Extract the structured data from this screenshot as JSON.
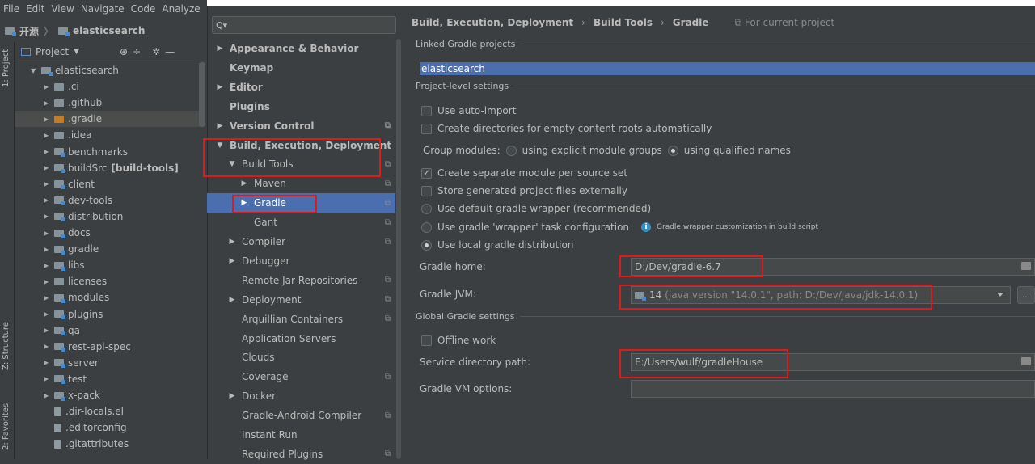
{
  "menubar": {
    "items": [
      "File",
      "Edit",
      "View",
      "Navigate",
      "Code",
      "Analyze"
    ]
  },
  "navbar": {
    "crumbs": [
      "开源",
      "elasticsearch"
    ]
  },
  "sidetabs": {
    "project": "1: Project",
    "structure": "Z: Structure",
    "favorites": "2: Favorites"
  },
  "project_panel": {
    "title": "Project"
  },
  "tree": [
    {
      "label": "elasticsearch",
      "level": 0,
      "expanded": true
    },
    {
      "label": ".ci",
      "level": 1
    },
    {
      "label": ".github",
      "level": 1
    },
    {
      "label": ".gradle",
      "level": 1,
      "selected": true
    },
    {
      "label": ".idea",
      "level": 1
    },
    {
      "label": "benchmarks",
      "level": 1
    },
    {
      "label": "buildSrc",
      "suffix": "[build-tools]",
      "level": 1
    },
    {
      "label": "client",
      "level": 1
    },
    {
      "label": "dev-tools",
      "level": 1
    },
    {
      "label": "distribution",
      "level": 1
    },
    {
      "label": "docs",
      "level": 1
    },
    {
      "label": "gradle",
      "level": 1
    },
    {
      "label": "libs",
      "level": 1
    },
    {
      "label": "licenses",
      "level": 1
    },
    {
      "label": "modules",
      "level": 1
    },
    {
      "label": "plugins",
      "level": 1
    },
    {
      "label": "qa",
      "level": 1
    },
    {
      "label": "rest-api-spec",
      "level": 1
    },
    {
      "label": "server",
      "level": 1
    },
    {
      "label": "test",
      "level": 1
    },
    {
      "label": "x-pack",
      "level": 1
    },
    {
      "label": ".dir-locals.el",
      "level": 1,
      "file": true
    },
    {
      "label": ".editorconfig",
      "level": 1,
      "file": true
    },
    {
      "label": ".gitattributes",
      "level": 1,
      "file": true
    }
  ],
  "dialog": {
    "search_placeholder": "Q▾"
  },
  "settings_tree": [
    {
      "label": "Appearance & Behavior",
      "bold": true,
      "arrow": "▶",
      "indent": 0
    },
    {
      "label": "Keymap",
      "bold": true,
      "arrow": "",
      "indent": 0
    },
    {
      "label": "Editor",
      "bold": true,
      "arrow": "▶",
      "indent": 0
    },
    {
      "label": "Plugins",
      "bold": true,
      "arrow": "",
      "indent": 0
    },
    {
      "label": "Version Control",
      "bold": true,
      "arrow": "▶",
      "indent": 0,
      "proj": true
    },
    {
      "label": "Build, Execution, Deployment",
      "bold": true,
      "arrow": "▼",
      "indent": 0
    },
    {
      "label": "Build Tools",
      "arrow": "▼",
      "indent": 1,
      "proj": true
    },
    {
      "label": "Maven",
      "arrow": "▶",
      "indent": 2,
      "proj": true
    },
    {
      "label": "Gradle",
      "arrow": "▶",
      "indent": 2,
      "proj": true,
      "selected": true
    },
    {
      "label": "Gant",
      "arrow": "",
      "indent": 2,
      "proj": true
    },
    {
      "label": "Compiler",
      "arrow": "▶",
      "indent": 1,
      "proj": true
    },
    {
      "label": "Debugger",
      "arrow": "▶",
      "indent": 1
    },
    {
      "label": "Remote Jar Repositories",
      "arrow": "",
      "indent": 1,
      "proj": true
    },
    {
      "label": "Deployment",
      "arrow": "▶",
      "indent": 1,
      "proj": true
    },
    {
      "label": "Arquillian Containers",
      "arrow": "",
      "indent": 1,
      "proj": true
    },
    {
      "label": "Application Servers",
      "arrow": "",
      "indent": 1
    },
    {
      "label": "Clouds",
      "arrow": "",
      "indent": 1
    },
    {
      "label": "Coverage",
      "arrow": "",
      "indent": 1,
      "proj": true
    },
    {
      "label": "Docker",
      "arrow": "▶",
      "indent": 1
    },
    {
      "label": "Gradle-Android Compiler",
      "arrow": "",
      "indent": 1,
      "proj": true
    },
    {
      "label": "Instant Run",
      "arrow": "",
      "indent": 1
    },
    {
      "label": "Required Plugins",
      "arrow": "",
      "indent": 1,
      "proj": true
    }
  ],
  "breadcrumb": {
    "a": "Build, Execution, Deployment",
    "b": "Build Tools",
    "c": "Gradle",
    "sep": "›",
    "scope": "For current project"
  },
  "sections": {
    "linked": "Linked Gradle projects",
    "project_level": "Project-level settings",
    "global": "Global Gradle settings"
  },
  "linked_project": "elasticsearch",
  "options": {
    "auto_import": {
      "label": "Use auto-import",
      "checked": false
    },
    "create_dirs": {
      "label": "Create directories for empty content roots automatically",
      "checked": false
    },
    "group_modules_label": "Group modules:",
    "explicit_groups": {
      "label": "using explicit module groups",
      "selected": false
    },
    "qualified_names": {
      "label": "using qualified names",
      "selected": true
    },
    "separate_module": {
      "label": "Create separate module per source set",
      "checked": true
    },
    "store_external": {
      "label": "Store generated project files externally",
      "checked": false
    },
    "default_wrapper": {
      "label": "Use default gradle wrapper (recommended)",
      "selected": false
    },
    "wrapper_task": {
      "label": "Use gradle 'wrapper' task configuration",
      "selected": false
    },
    "wrapper_hint": "Gradle wrapper customization in build script",
    "local_distribution": {
      "label": "Use local gradle distribution",
      "selected": true
    },
    "offline": {
      "label": "Offline work",
      "checked": false
    }
  },
  "fields": {
    "gradle_home_label": "Gradle home:",
    "gradle_home_value": "D:/Dev/gradle-6.7",
    "gradle_jvm_label": "Gradle JVM:",
    "gradle_jvm_version": "14",
    "gradle_jvm_detail": "(java version \"14.0.1\", path: D:/Dev/Java/jdk-14.0.1)",
    "service_dir_label": "Service directory path:",
    "service_dir_value": "E:/Users/wulf/gradleHouse",
    "vm_options_label": "Gradle VM options:",
    "vm_options_value": "",
    "more_button": "..."
  },
  "colors": {
    "accent": "#4b6eaf",
    "highlight_box": "#e0191b",
    "background": "#3c3f41"
  }
}
